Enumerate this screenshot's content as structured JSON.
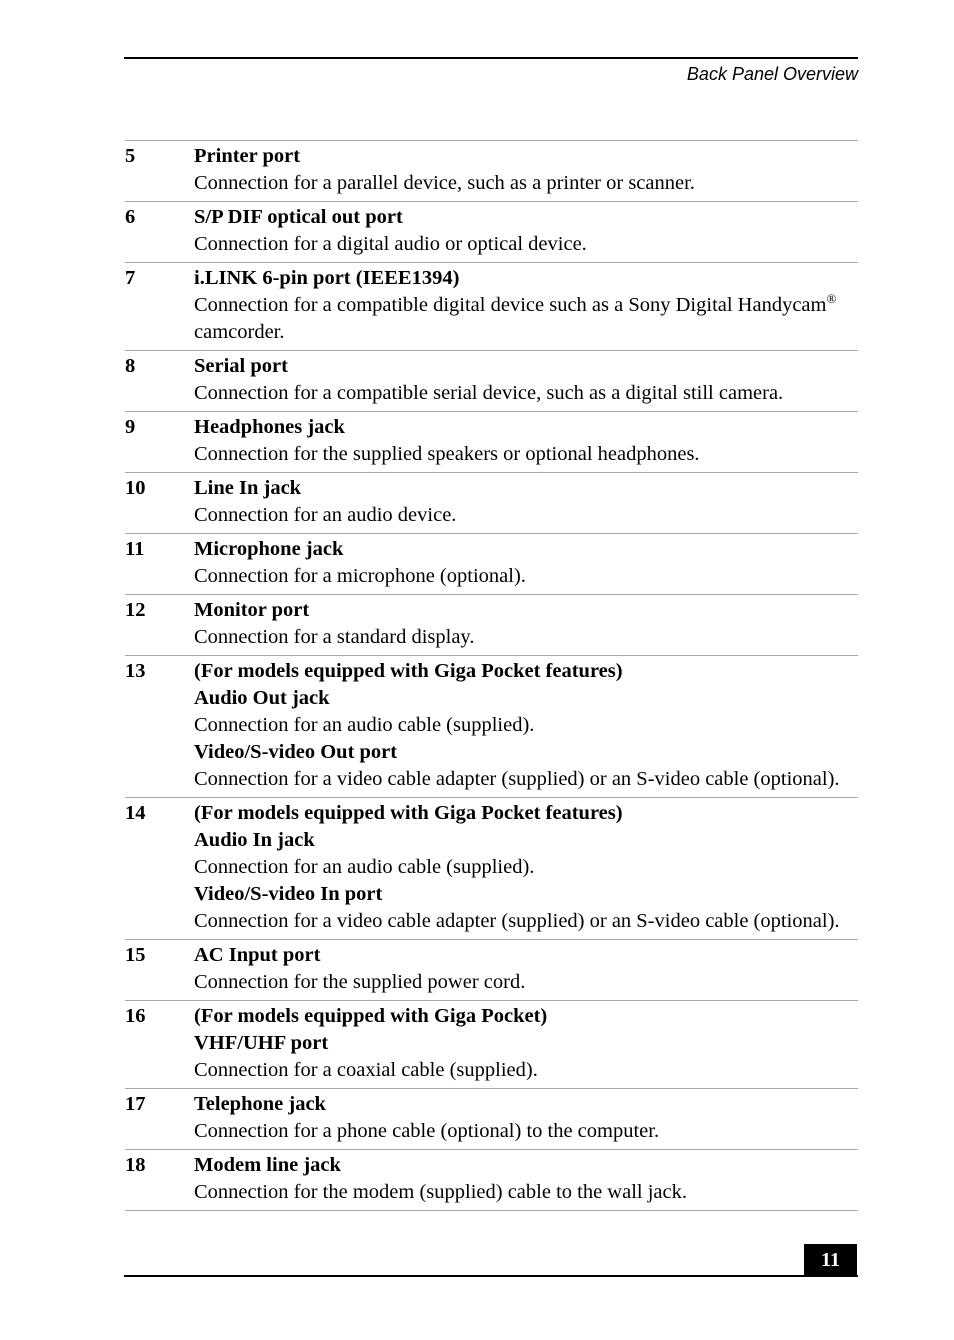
{
  "header": {
    "running_title": "Back Panel Overview"
  },
  "entries": [
    {
      "number": "5",
      "blocks": [
        {
          "type": "title",
          "text": "Printer port"
        },
        {
          "type": "desc",
          "text": "Connection for a parallel device, such as a printer or scanner."
        }
      ]
    },
    {
      "number": "6",
      "blocks": [
        {
          "type": "title",
          "text": "S/P DIF optical out port"
        },
        {
          "type": "desc",
          "text": "Connection for a digital audio or optical device."
        }
      ]
    },
    {
      "number": "7",
      "blocks": [
        {
          "type": "title",
          "text": "i.LINK 6-pin port (IEEE1394)"
        },
        {
          "type": "desc",
          "text": "Connection for a compatible digital device such as a Sony Digital Handycam",
          "sup": "®",
          "after": " camcorder."
        }
      ]
    },
    {
      "number": "8",
      "blocks": [
        {
          "type": "title",
          "text": "Serial port"
        },
        {
          "type": "desc",
          "text": "Connection for a compatible serial device, such as a digital still camera."
        }
      ]
    },
    {
      "number": "9",
      "blocks": [
        {
          "type": "title",
          "text": "Headphones jack"
        },
        {
          "type": "desc",
          "text": "Connection for the supplied speakers or optional headphones."
        }
      ]
    },
    {
      "number": "10",
      "blocks": [
        {
          "type": "title",
          "text": "Line In jack"
        },
        {
          "type": "desc",
          "text": "Connection for an audio device."
        }
      ]
    },
    {
      "number": "11",
      "blocks": [
        {
          "type": "title",
          "text": "Microphone jack"
        },
        {
          "type": "desc",
          "text": "Connection for a microphone (optional)."
        }
      ]
    },
    {
      "number": "12",
      "blocks": [
        {
          "type": "title",
          "text": "Monitor port"
        },
        {
          "type": "desc",
          "text": "Connection for a standard display."
        }
      ]
    },
    {
      "number": "13",
      "blocks": [
        {
          "type": "title",
          "text": "(For models equipped with Giga Pocket features)"
        },
        {
          "type": "title",
          "text": "Audio Out jack"
        },
        {
          "type": "desc",
          "text": "Connection for an audio cable (supplied)."
        },
        {
          "type": "title",
          "text": "Video/S-video Out port"
        },
        {
          "type": "desc",
          "text": "Connection for a video cable adapter (supplied) or an S-video cable (optional)."
        }
      ]
    },
    {
      "number": "14",
      "blocks": [
        {
          "type": "title",
          "text": "(For models equipped with Giga Pocket features)"
        },
        {
          "type": "title",
          "text": "Audio In jack"
        },
        {
          "type": "desc",
          "text": "Connection for an audio cable (supplied)."
        },
        {
          "type": "title",
          "text": "Video/S-video In port"
        },
        {
          "type": "desc",
          "text": "Connection for a video cable adapter (supplied) or an S-video cable (optional)."
        }
      ]
    },
    {
      "number": "15",
      "blocks": [
        {
          "type": "title",
          "text": "AC Input port"
        },
        {
          "type": "desc",
          "text": "Connection for the supplied power cord."
        }
      ]
    },
    {
      "number": "16",
      "blocks": [
        {
          "type": "title",
          "text": "(For models equipped with Giga Pocket)"
        },
        {
          "type": "title",
          "text": "VHF/UHF port"
        },
        {
          "type": "desc",
          "text": "Connection for a coaxial cable (supplied)."
        }
      ]
    },
    {
      "number": "17",
      "blocks": [
        {
          "type": "title",
          "text": "Telephone jack"
        },
        {
          "type": "desc",
          "text": "Connection for a phone cable (optional) to the computer."
        }
      ]
    },
    {
      "number": "18",
      "blocks": [
        {
          "type": "title",
          "text": "Modem line jack"
        },
        {
          "type": "desc",
          "text": "Connection for the modem (supplied) cable to the wall jack."
        }
      ]
    }
  ],
  "footer": {
    "page_number": "11"
  },
  "colors": {
    "rule": "#a8a8a8",
    "text": "#000000",
    "page_badge_bg": "#000000",
    "page_badge_text": "#ffffff"
  }
}
